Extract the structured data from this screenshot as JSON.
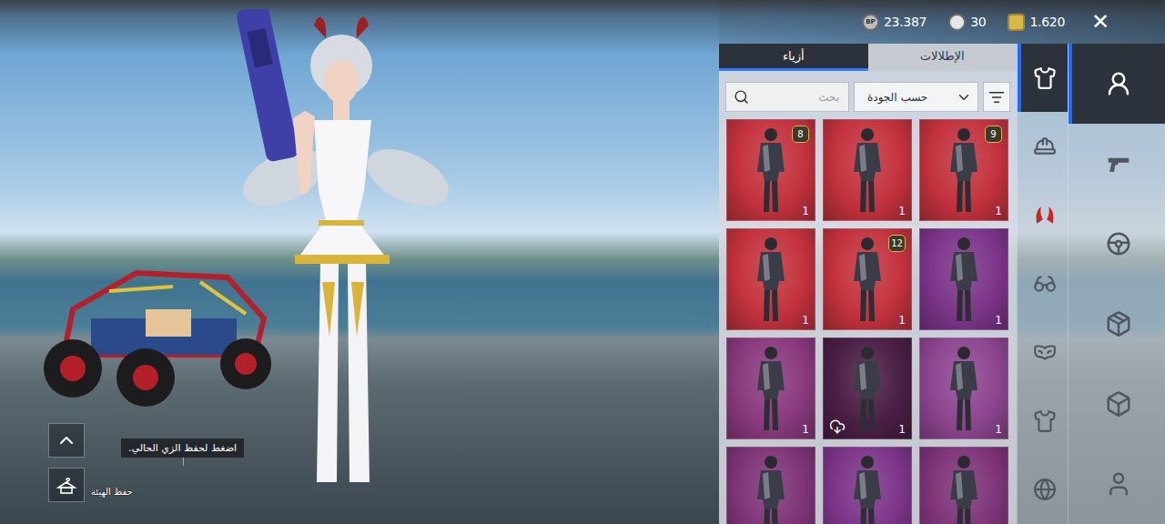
{
  "topbar": {
    "currencies": [
      {
        "kind": "bp",
        "symbol": "BP",
        "amount": "23.387"
      },
      {
        "kind": "silver",
        "symbol": "",
        "amount": "30"
      },
      {
        "kind": "uc",
        "symbol": "",
        "amount": "1.620"
      }
    ],
    "close": "✕"
  },
  "panel": {
    "tabs": [
      {
        "label": "أزياء",
        "selected": true
      },
      {
        "label": "الإطلالات",
        "selected": false
      }
    ],
    "sort": {
      "label": "حسب الجودة"
    },
    "search": {
      "placeholder": "بحث"
    },
    "items": [
      {
        "badge": "8",
        "count": "1",
        "color": "#c3323e",
        "downloading": false
      },
      {
        "badge": "",
        "count": "1",
        "color": "#c3323e",
        "downloading": false
      },
      {
        "badge": "9",
        "count": "1",
        "color": "#c3323e",
        "downloading": false
      },
      {
        "badge": "",
        "count": "1",
        "color": "#c3323e",
        "downloading": false
      },
      {
        "badge": "12",
        "count": "1",
        "color": "#c3323e",
        "downloading": false
      },
      {
        "badge": "",
        "count": "1",
        "color": "#7c3589",
        "downloading": false
      },
      {
        "badge": "",
        "count": "1",
        "color": "#8a3a7e",
        "downloading": false
      },
      {
        "badge": "",
        "count": "1",
        "color": "#4a1f45",
        "downloading": true
      },
      {
        "badge": "",
        "count": "1",
        "color": "#8d4690",
        "downloading": false
      },
      {
        "badge": "",
        "count": "",
        "color": "#7e3478",
        "downloading": false
      },
      {
        "badge": "",
        "count": "",
        "color": "#7c3589",
        "downloading": false
      },
      {
        "badge": "",
        "count": "",
        "color": "#7e3478",
        "downloading": false
      }
    ]
  },
  "categories": {
    "primary": [
      {
        "kind": "outfit",
        "selected": true
      },
      {
        "kind": "helmet",
        "selected": false
      },
      {
        "kind": "horns",
        "selected": false
      },
      {
        "kind": "glasses",
        "selected": false
      },
      {
        "kind": "mask",
        "selected": false
      },
      {
        "kind": "jacket",
        "selected": false
      },
      {
        "kind": "ball",
        "selected": false
      }
    ],
    "secondary": [
      {
        "kind": "avatar",
        "selected": true
      },
      {
        "kind": "pistol",
        "selected": false
      },
      {
        "kind": "wheel",
        "selected": false
      },
      {
        "kind": "crate",
        "selected": false
      },
      {
        "kind": "box",
        "selected": false
      },
      {
        "kind": "person",
        "selected": false
      }
    ]
  },
  "save_outfit": {
    "tooltip": "اضغط لحفظ الزي الحالي.",
    "label": "حفظ الهيئة"
  }
}
